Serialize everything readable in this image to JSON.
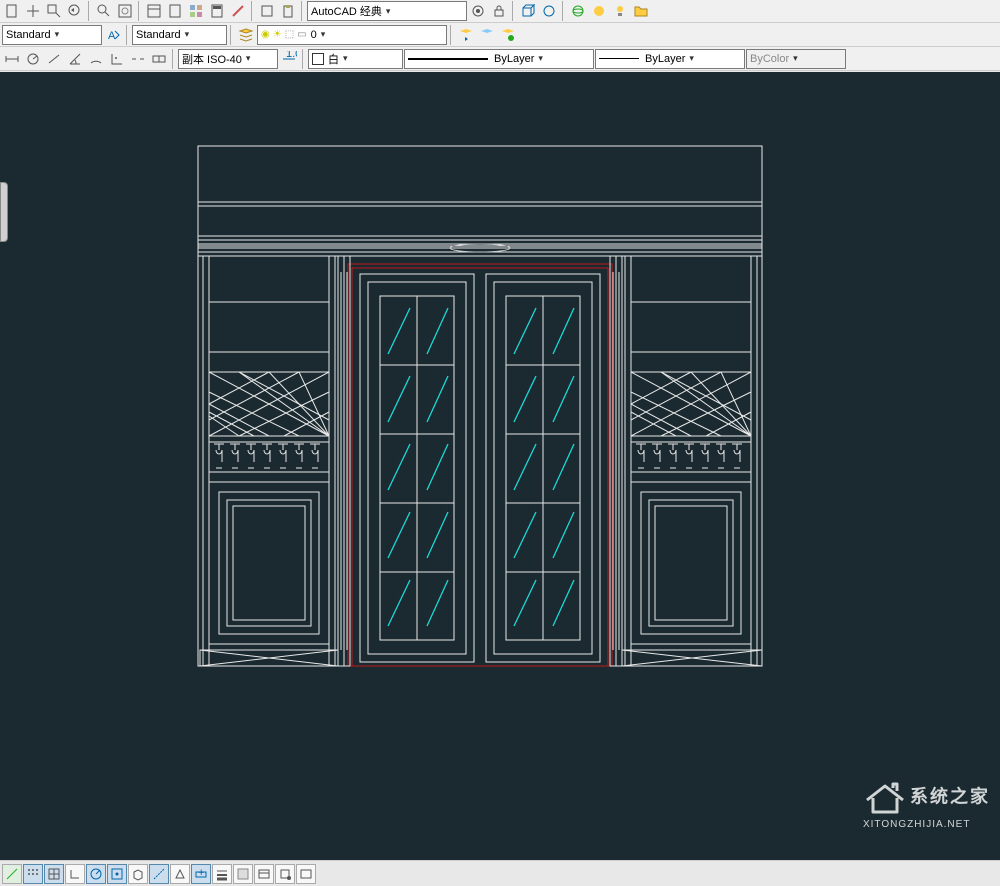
{
  "workspace_select": "AutoCAD 经典",
  "textstyle1": "Standard",
  "textstyle2": "Standard",
  "layer_name": "0",
  "dim_style": "副本 ISO-40",
  "color_select": "白",
  "linetype_select": "ByLayer",
  "lineweight_select": "ByLayer",
  "plotstyle_select": "ByColor",
  "watermark_title": "系统之家",
  "watermark_url": "XITONGZHIJIA.NET",
  "accent_red": "#c01818",
  "accent_cyan": "#1dd8d8",
  "bg_dark": "#1a2a30"
}
